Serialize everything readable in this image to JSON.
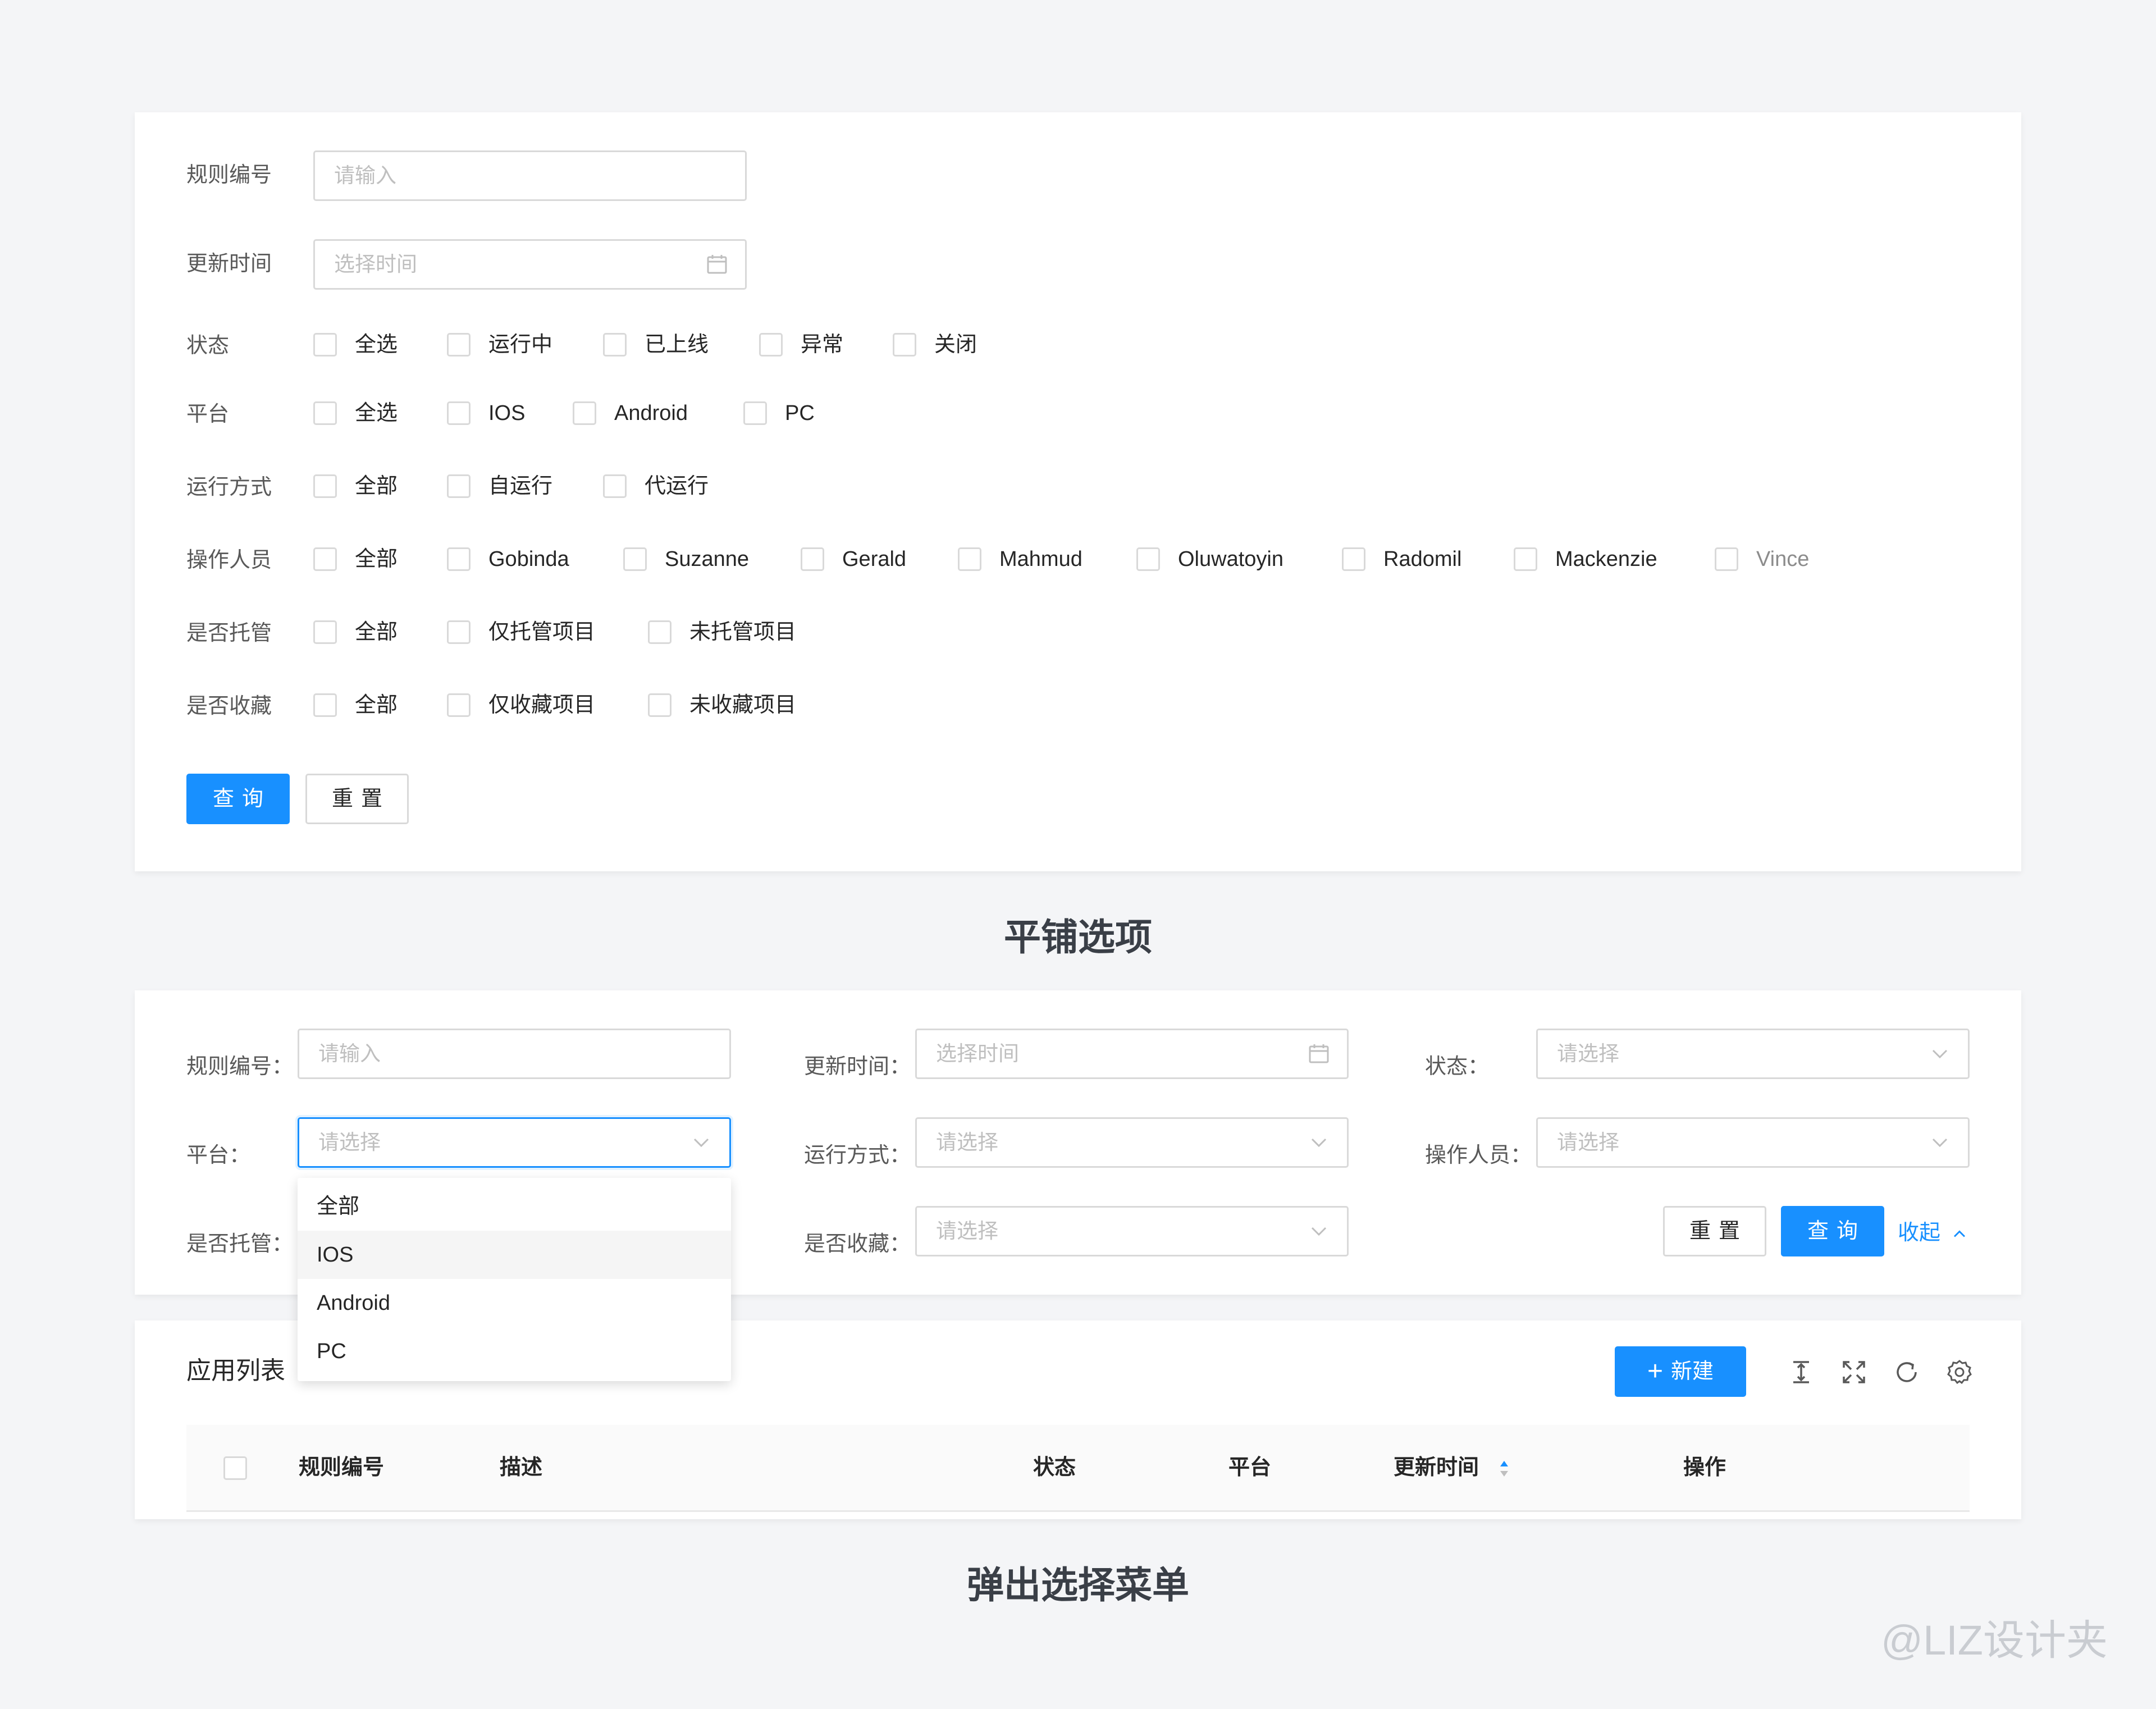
{
  "tiled": {
    "rule_no_label": "规则编号",
    "rule_no_placeholder": "请输入",
    "update_time_label": "更新时间",
    "update_time_placeholder": "选择时间",
    "status_label": "状态",
    "status_options": [
      "全选",
      "运行中",
      "已上线",
      "异常",
      "关闭"
    ],
    "platform_label": "平台",
    "platform_options": [
      "全选",
      "IOS",
      "Android",
      "PC"
    ],
    "run_mode_label": "运行方式",
    "run_mode_options": [
      "全部",
      "自运行",
      "代运行"
    ],
    "operator_label": "操作人员",
    "operator_options": [
      "全部",
      "Gobinda",
      "Suzanne",
      "Gerald",
      "Mahmud",
      "Oluwatoyin",
      "Radomil",
      "Mackenzie",
      "Vince"
    ],
    "hosted_label": "是否托管",
    "hosted_options": [
      "全部",
      "仅托管项目",
      "未托管项目"
    ],
    "favorite_label": "是否收藏",
    "favorite_options": [
      "全部",
      "仅收藏项目",
      "未收藏项目"
    ],
    "query_button": "查询",
    "reset_button": "重置"
  },
  "caption_tiled": "平铺选项",
  "popup": {
    "rule_no_label": "规则编号：",
    "rule_no_placeholder": "请输入",
    "update_time_label": "更新时间：",
    "update_time_placeholder": "选择时间",
    "status_label": "状态：",
    "status_placeholder": "请选择",
    "platform_label": "平台：",
    "platform_placeholder": "请选择",
    "run_mode_label": "运行方式：",
    "run_mode_placeholder": "请选择",
    "operator_label": "操作人员：",
    "operator_placeholder": "请选择",
    "hosted_label": "是否托管：",
    "favorite_label": "是否收藏：",
    "favorite_placeholder": "请选择",
    "reset_button": "重置",
    "query_button": "查询",
    "collapse_link": "收起",
    "dropdown_options": [
      "全部",
      "IOS",
      "Android",
      "PC"
    ],
    "dropdown_active_index": 1
  },
  "table": {
    "title": "应用列表",
    "new_button": "新建",
    "columns": [
      "规则编号",
      "描述",
      "状态",
      "平台",
      "更新时间",
      "操作"
    ]
  },
  "caption_popup": "弹出选择菜单",
  "watermark": "@LIZ设计夹",
  "colors": {
    "primary": "#1890ff",
    "border": "#d9d9d9",
    "placeholder": "#bfbfbf"
  }
}
